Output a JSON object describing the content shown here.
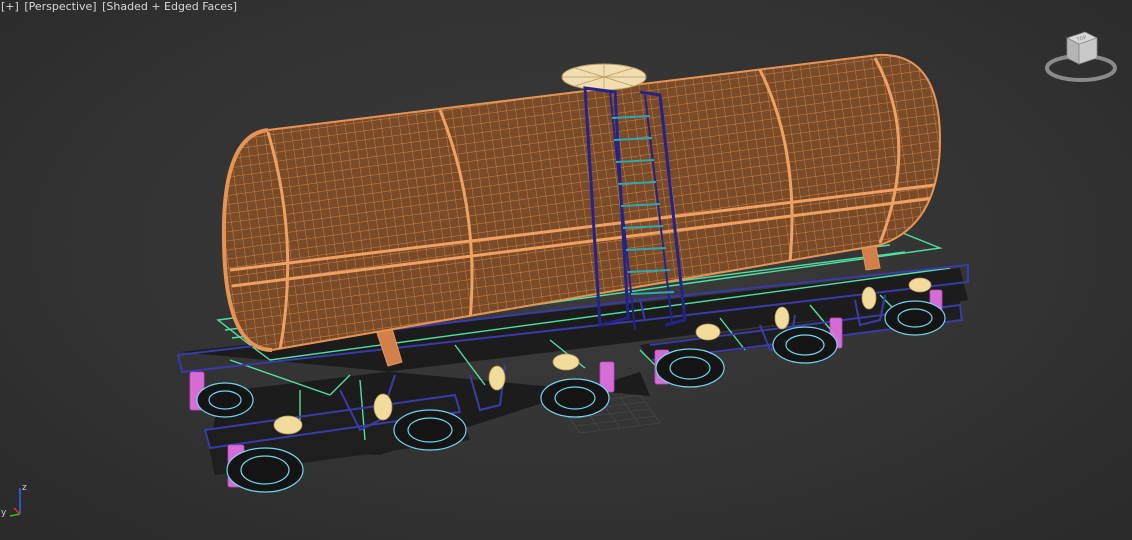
{
  "viewport": {
    "labels": {
      "plus_menu": "[+]",
      "point_of_view": "[Perspective]",
      "shading": "[Shaded + Edged Faces]"
    },
    "viewcube_label": "TOP",
    "axis_labels": {
      "x": "x",
      "y": "y",
      "z": "z"
    },
    "scene_object": "railway tank car"
  },
  "colors": {
    "background": "#363636",
    "tank_wireframe": "#e59455",
    "dome_hatch": "#f0ddb0",
    "ladder_frame": "#23238a",
    "ladder_rungs": "#2fa8b4",
    "underframe_edges": "#4fe0a0",
    "bogie_edges": "#3a3aa8",
    "wheel_edges": "#6fd8f0",
    "springs": "#e070e0",
    "spring_boxes": "#f2dc9c",
    "axis_x": "#e03030",
    "axis_y": "#30c030",
    "axis_z": "#3060ff"
  }
}
